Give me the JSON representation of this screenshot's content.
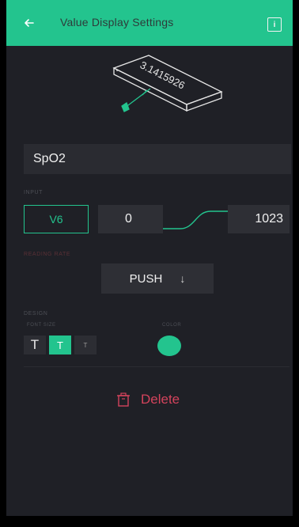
{
  "header": {
    "title": "Value Display Settings",
    "back_icon": "arrow-left-icon",
    "info_icon": "info-box-icon"
  },
  "preview": {
    "display_value": "3.1415926",
    "icon": "value-display-widget-icon"
  },
  "name_field": {
    "value": "SpO2"
  },
  "input": {
    "label": "INPUT",
    "pin": "V6",
    "min": "0",
    "max": "1023"
  },
  "reading_rate": {
    "label": "READING RATE",
    "value": "PUSH",
    "arrow": "↓"
  },
  "design": {
    "label": "DESIGN",
    "font_size_label": "FONT SIZE",
    "font_sizes": [
      "T",
      "T",
      "T"
    ],
    "selected_font_size": "medium",
    "color_label": "COLOR",
    "color": "#23c48e"
  },
  "delete": {
    "label": "Delete"
  },
  "colors": {
    "accent": "#23c48e",
    "background": "#1f2026",
    "danger": "#d3435c"
  }
}
